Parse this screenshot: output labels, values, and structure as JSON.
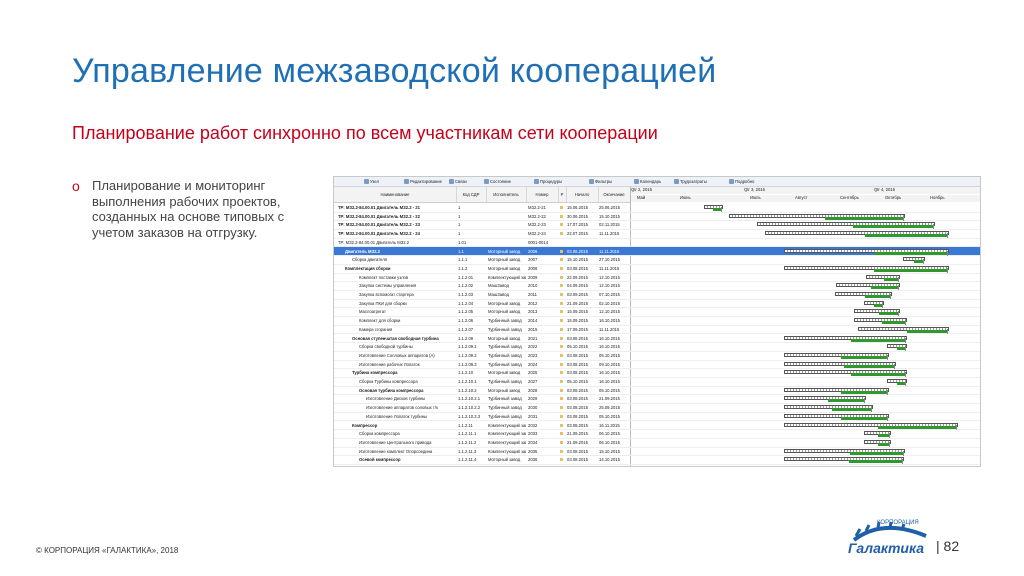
{
  "slide": {
    "title": "Управление межзаводской кооперацией",
    "subtitle": "Планирование работ синхронно по всем участникам сети кооперации",
    "bullet_marker": "o",
    "bullet_text": "Планирование и мониторинг выполнения рабочих проектов, созданных на основе типовых с учетом заказов на отгрузку.",
    "footer": "© КОРПОРАЦИЯ «ГАЛАКТИКА», 2018",
    "logo_sub": "КОРПОРАЦИЯ",
    "logo_name": "Галактика",
    "page_number": "| 82"
  },
  "app": {
    "toolbar": [
      "Узел",
      "Редактирование",
      "Связи",
      "Состояние",
      "Процедуры",
      "Фильтры",
      "Календарь",
      "Трудозатраты",
      "Подробно"
    ],
    "columns": [
      "Наименование",
      "Код СДР",
      "Исполнитель",
      "Номер",
      "Р",
      "Начало",
      "Окончание"
    ],
    "gantt_quarters": [
      "Qtr 2, 2015",
      "Qtr 3, 2015",
      "Qtr 4, 2015"
    ],
    "gantt_months": [
      "Май",
      "Июнь",
      "Июль",
      "Август",
      "Сентябрь",
      "Октябрь",
      "Ноябрь"
    ],
    "rows": [
      {
        "name": "ТР: МЗ2.2-84.00.01 Двигатель МЗ2.2 - 21",
        "code": "1",
        "exec": "",
        "num": "МЗ2.2-21",
        "start": "15.06.2015",
        "end": "25.06.2015",
        "bold": true,
        "indent": 0
      },
      {
        "name": "ТР: МЗ2.2-84.00.01 Двигатель МЗ2.2 - 22",
        "code": "1",
        "exec": "",
        "num": "МЗ2.2-22",
        "start": "30.06.2015",
        "end": "15.10.2015",
        "bold": true,
        "indent": 0
      },
      {
        "name": "ТР: МЗ2.2-84.00.01 Двигатель МЗ2.2 - 23",
        "code": "1",
        "exec": "",
        "num": "МЗ2.2-23",
        "start": "17.07.2015",
        "end": "02.11.2015",
        "bold": true,
        "indent": 0
      },
      {
        "name": "ТР: МЗ2.2-84.00.01 Двигатель МЗ2.2 - 24",
        "code": "1",
        "exec": "",
        "num": "МЗ2.2-24",
        "start": "22.07.2015",
        "end": "11.11.2015",
        "bold": true,
        "indent": 0
      },
      {
        "name": "ТР: МЗ2.2-84.00.01 Двигатель МЗ2.2",
        "code": "1.01",
        "exec": "",
        "num": "0001-0014",
        "start": "",
        "end": "",
        "bold": false,
        "indent": 0
      },
      {
        "name": "Двигатель МЗ2.2",
        "code": "1.1",
        "exec": "Моторный завод",
        "num": "2006",
        "start": "03.08.2015",
        "end": "11.11.2015",
        "bold": true,
        "indent": 1,
        "sel": true
      },
      {
        "name": "Сборка двигателя",
        "code": "1.1.1",
        "exec": "Моторный завод",
        "num": "2007",
        "start": "15.10.2015",
        "end": "27.10.2015",
        "bold": false,
        "indent": 2
      },
      {
        "name": "Комплектация сборки",
        "code": "1.1.2",
        "exec": "Моторный завод",
        "num": "2008",
        "start": "03.08.2015",
        "end": "11.11.2015",
        "bold": true,
        "indent": 1
      },
      {
        "name": "Комплект поставки узлов",
        "code": "1.1.2.01",
        "exec": "Комплектующий завод",
        "num": "2009",
        "start": "22.09.2015",
        "end": "12.10.2015",
        "bold": false,
        "indent": 3
      },
      {
        "name": "Закупка системы управления",
        "code": "1.1.2.02",
        "exec": "МашЗавод",
        "num": "2010",
        "start": "04.09.2015",
        "end": "12.10.2015",
        "bold": false,
        "indent": 3
      },
      {
        "name": "Закупка вспомогат стартера",
        "code": "1.1.2.03",
        "exec": "МашЗавод",
        "num": "2011",
        "start": "03.09.2015",
        "end": "07.10.2015",
        "bold": false,
        "indent": 3
      },
      {
        "name": "Закупка ПКИ для сборки",
        "code": "1.1.2.04",
        "exec": "Моторный завод",
        "num": "2012",
        "start": "21.09.2015",
        "end": "02.10.2015",
        "bold": false,
        "indent": 3
      },
      {
        "name": "Маслоагрегат",
        "code": "1.1.2.05",
        "exec": "Моторный завод",
        "num": "2013",
        "start": "15.09.2015",
        "end": "12.10.2015",
        "bold": false,
        "indent": 3
      },
      {
        "name": "Комплект для сборки",
        "code": "1.1.2.06",
        "exec": "Турбинный завод",
        "num": "2014",
        "start": "15.09.2015",
        "end": "16.10.2015",
        "bold": false,
        "indent": 3
      },
      {
        "name": "Камера сгорания",
        "code": "1.1.2.07",
        "exec": "Турбинный завод",
        "num": "2015",
        "start": "17.09.2015",
        "end": "11.11.2015",
        "bold": false,
        "indent": 3
      },
      {
        "name": "Основая ступенчатая свободная турбина",
        "code": "1.1.2.09",
        "exec": "Моторный завод",
        "num": "2021",
        "start": "03.08.2015",
        "end": "16.10.2015",
        "bold": true,
        "indent": 2
      },
      {
        "name": "Сборка свободной турбины",
        "code": "1.1.2.09.1",
        "exec": "Турбинный завод",
        "num": "2022",
        "start": "05.10.2015",
        "end": "16.10.2015",
        "bold": false,
        "indent": 3
      },
      {
        "name": "Изготовление Сопловых аппаратов (А)",
        "code": "1.1.2.09.2",
        "exec": "Турбинный завод",
        "num": "2023",
        "start": "03.08.2015",
        "end": "05.10.2015",
        "bold": false,
        "indent": 3
      },
      {
        "name": "Изготовление рабочих Лопаток",
        "code": "1.1.2.09.3",
        "exec": "Турбинный завод",
        "num": "2024",
        "start": "03.08.2015",
        "end": "09.10.2015",
        "bold": false,
        "indent": 3
      },
      {
        "name": "Турбина компрессора",
        "code": "1.1.2.10",
        "exec": "Моторный завод",
        "num": "2025",
        "start": "03.08.2015",
        "end": "16.10.2015",
        "bold": true,
        "indent": 2
      },
      {
        "name": "Сборка Турбины компрессора",
        "code": "1.1.2.10.1",
        "exec": "Турбинный завод",
        "num": "2027",
        "start": "05.10.2015",
        "end": "16.10.2015",
        "bold": false,
        "indent": 3
      },
      {
        "name": "Основая турбина компрессора",
        "code": "1.1.2.10.2",
        "exec": "Моторный завод",
        "num": "2028",
        "start": "03.08.2015",
        "end": "05.10.2015",
        "bold": true,
        "indent": 3
      },
      {
        "name": "Изготовление Дисков турбины",
        "code": "1.1.2.10.2.1",
        "exec": "Турбинный завод",
        "num": "2029",
        "start": "03.08.2015",
        "end": "21.09.2015",
        "bold": false,
        "indent": 4
      },
      {
        "name": "Изготовление аппаратов соловых т/к",
        "code": "1.1.2.10.2.2",
        "exec": "Турбинный завод",
        "num": "2030",
        "start": "03.08.2015",
        "end": "25.09.2015",
        "bold": false,
        "indent": 4
      },
      {
        "name": "Изготовление Лопаток турбины",
        "code": "1.1.2.10.2.3",
        "exec": "Турбинный завод",
        "num": "2031",
        "start": "03.08.2015",
        "end": "05.10.2015",
        "bold": false,
        "indent": 4
      },
      {
        "name": "Компрессор",
        "code": "1.1.2.11",
        "exec": "Комплектующий завод",
        "num": "2032",
        "start": "03.08.2015",
        "end": "16.11.2015",
        "bold": true,
        "indent": 2
      },
      {
        "name": "Сборка компрессора",
        "code": "1.1.2.11.1",
        "exec": "Комплектующий завод",
        "num": "2033",
        "start": "21.09.2015",
        "end": "06.10.2015",
        "bold": false,
        "indent": 3
      },
      {
        "name": "Изготовление Центрального привода",
        "code": "1.1.2.11.2",
        "exec": "Комплектующий завод",
        "num": "2034",
        "start": "21.09.2015",
        "end": "06.10.2015",
        "bold": false,
        "indent": 3
      },
      {
        "name": "Изготовление комплект Опорсоедина",
        "code": "1.1.2.11.3",
        "exec": "Комплектующий завод",
        "num": "2035",
        "start": "03.08.2015",
        "end": "15.10.2015",
        "bold": false,
        "indent": 3
      },
      {
        "name": "Осевой компрессор",
        "code": "1.1.2.11.4",
        "exec": "Моторный завод",
        "num": "2036",
        "start": "03.08.2015",
        "end": "14.10.2015",
        "bold": true,
        "indent": 3
      },
      {
        "name": "Изготовление Направляющих лопаток",
        "code": "1.1.2.11.4.1",
        "exec": "Комплектующий завод",
        "num": "2041",
        "start": "03.08.2015",
        "end": "23.09.2015",
        "bold": false,
        "indent": 4
      }
    ]
  },
  "colors": {
    "title": "#1f6fb5",
    "subtitle": "#c5001a",
    "selected_row": "#3a78d6",
    "actual_bar": "#2e9a2e"
  }
}
